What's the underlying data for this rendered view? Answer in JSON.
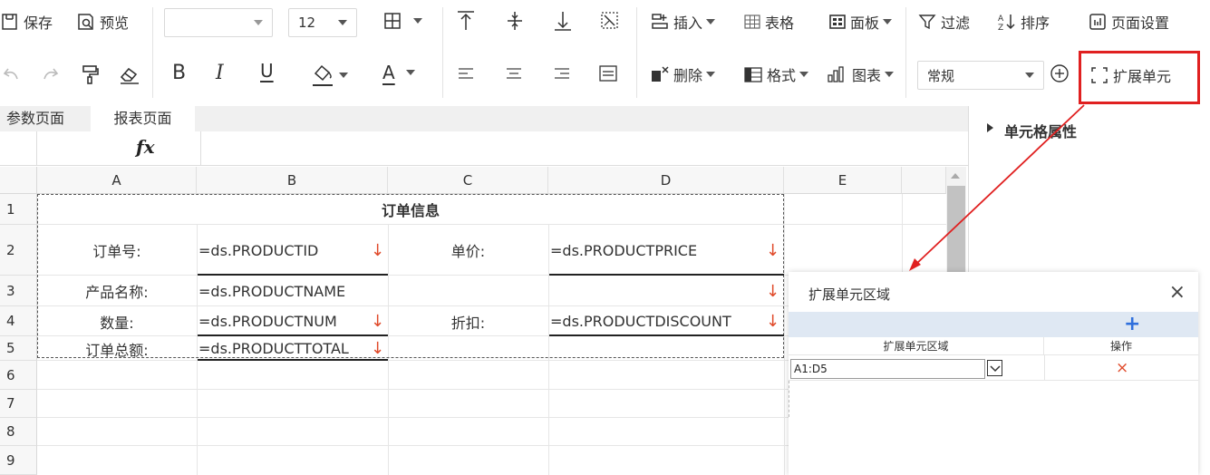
{
  "toolbar": {
    "save": "保存",
    "preview": "预览",
    "font_name": "",
    "font_size": "12",
    "bold": "B",
    "italic": "I",
    "underline": "U",
    "font_color": "A",
    "insert": "插入",
    "table": "表格",
    "panel": "面板",
    "filter": "过滤",
    "sort": "排序",
    "page_setup": "页面设置",
    "delete": "删除",
    "format": "格式",
    "chart": "图表",
    "number_format": "常规",
    "expand_cell": "扩展单元"
  },
  "tabs": [
    "参数页面",
    "报表页面"
  ],
  "formula_bar": {
    "fx": "fx"
  },
  "columns": [
    "A",
    "B",
    "C",
    "D",
    "E"
  ],
  "rows": [
    "1",
    "2",
    "3",
    "4",
    "5",
    "6",
    "7",
    "8",
    "9"
  ],
  "cells": {
    "title": "订单信息",
    "order_no_label": "订单号:",
    "order_no_value": "=ds.PRODUCTID",
    "price_label": "单价:",
    "price_value": "=ds.PRODUCTPRICE",
    "product_name_label": "产品名称:",
    "product_name_value": "=ds.PRODUCTNAME",
    "qty_label": "数量:",
    "qty_value": "=ds.PRODUCTNUM",
    "discount_label": "折扣:",
    "discount_value": "=ds.PRODUCTDISCOUNT",
    "total_label": "订单总额:",
    "total_value": "=ds.PRODUCTTOTAL",
    "expand_arrow": "↓"
  },
  "right_panel": {
    "title": "单元格属性"
  },
  "dialog": {
    "title": "扩展单元区域",
    "close": "×",
    "add": "+",
    "col_region": "扩展单元区域",
    "col_action": "操作",
    "region_value": "A1:D5",
    "delete": "×"
  },
  "colors": {
    "highlight_red": "#e02020",
    "arrow_red": "#e04a2a",
    "accent_blue": "#2f6fdc"
  }
}
